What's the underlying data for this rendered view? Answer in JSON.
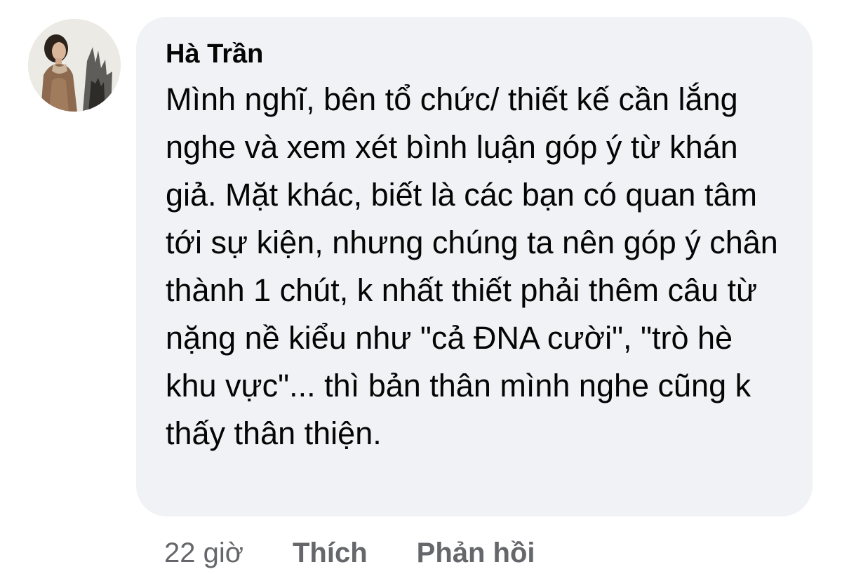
{
  "comment": {
    "author": "Hà Trần",
    "text": "Mình nghĩ, bên tổ chức/ thiết kế cần lắng nghe và xem xét bình luận góp ý từ khán giả. Mặt khác, biết là các bạn có quan tâm tới sự kiện, nhưng chúng ta nên góp ý chân thành 1 chút, k nhất thiết phải thêm câu từ nặng nề kiểu như \"cả ĐNA cười\", \"trò hè khu vực\"... thì bản thân mình nghe cũng k thấy thân thiện.",
    "time": "22 giờ",
    "like_label": "Thích",
    "reply_label": "Phản hồi"
  },
  "colors": {
    "bubble_bg": "#f0f2f5",
    "text": "#050505",
    "meta": "#65676b"
  }
}
